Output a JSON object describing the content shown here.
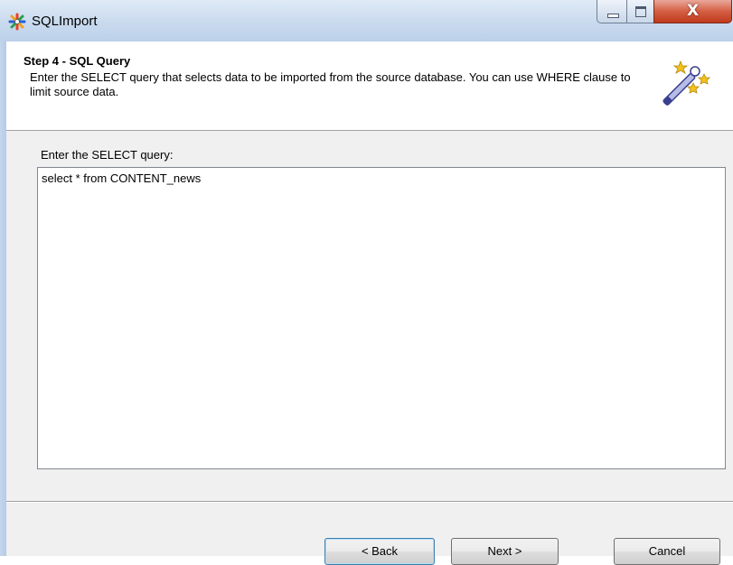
{
  "window": {
    "title": "SQLImport",
    "controls": {
      "minimize": "minimize",
      "maximize": "maximize",
      "close": "X"
    }
  },
  "header": {
    "step_title": "Step 4 - SQL Query",
    "description": "Enter the SELECT query that selects data to be imported from the source database. You can use WHERE clause to limit source data.",
    "icon": "magic-wand-icon"
  },
  "main": {
    "query_label": "Enter the SELECT query:",
    "query_value": "select * from CONTENT_news"
  },
  "buttons": {
    "back": "< Back",
    "next": "Next >",
    "cancel": "Cancel"
  },
  "colors": {
    "titlebar": "#c9daee",
    "close_button": "#c0391c",
    "dialog_background": "#f0f0f0"
  }
}
